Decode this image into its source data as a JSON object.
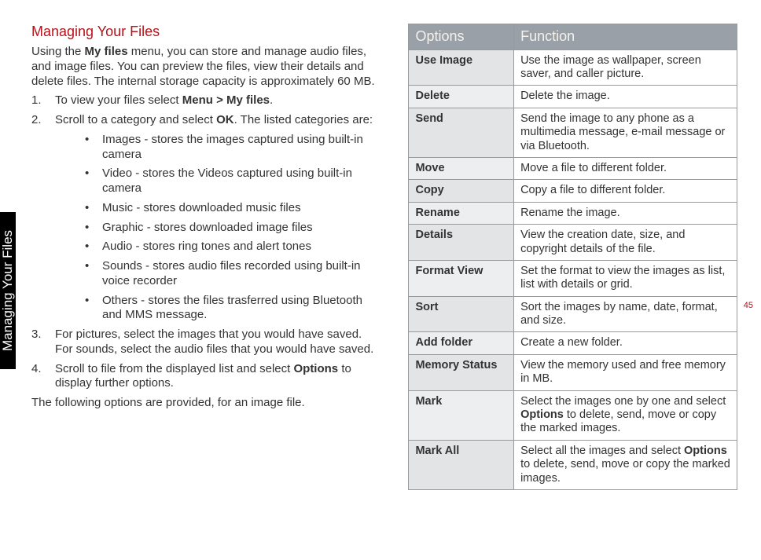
{
  "sideTab": "Managing Your Files",
  "pageNumber": "45",
  "left": {
    "heading": "Managing Your Files",
    "intro_parts": {
      "p1a": "Using the ",
      "p1b": "My files",
      "p1c": " menu, you can store and manage audio files, and image files. You can preview the files, view their details and delete files. The internal storage capacity is approximately 60 MB."
    },
    "step1": {
      "a": "To view your files select ",
      "b": "Menu > My files",
      "c": "."
    },
    "step2": {
      "a": "Scroll to a category and select ",
      "b": "OK",
      "c": ". The listed categories are:"
    },
    "bullets": [
      "Images - stores the images captured using built-in camera",
      "Video - stores the Videos captured using built-in camera",
      "Music - stores downloaded music files",
      "Graphic - stores downloaded image files",
      "Audio - stores ring tones and alert tones",
      "Sounds - stores audio files recorded using built-in voice recorder",
      "Others - stores the files trasferred using Bluetooth and MMS message."
    ],
    "step3": "For pictures, select the images that you would have saved. For sounds, select the audio files that you would have saved.",
    "step4": {
      "a": "Scroll to file from the displayed list and select ",
      "b": "Options",
      "c": " to display further options."
    },
    "outro": "The following options are provided, for an image file."
  },
  "table": {
    "header": {
      "c1": "Options",
      "c2": "Function"
    },
    "rows": [
      {
        "opt": "Use Image",
        "fn": "Use the image as wallpaper, screen saver, and caller picture."
      },
      {
        "opt": "Delete",
        "fn": "Delete the image."
      },
      {
        "opt": "Send",
        "fn": "Send the image to any phone as a multimedia message, e-mail message or via Bluetooth."
      },
      {
        "opt": "Move",
        "fn": "Move a file to different folder."
      },
      {
        "opt": "Copy",
        "fn": "Copy a file to different folder."
      },
      {
        "opt": "Rename",
        "fn": "Rename the image."
      },
      {
        "opt": "Details",
        "fn": "View the creation date, size, and copyright details of the file."
      },
      {
        "opt": "Format View",
        "fn": "Set the format to view the images as list, list with details or grid."
      },
      {
        "opt": "Sort",
        "fn": "Sort the images by name, date, format, and size."
      },
      {
        "opt": "Add folder",
        "fn": "Create a new folder."
      },
      {
        "opt": "Memory Status",
        "fn": "View the memory used and free memory in MB."
      },
      {
        "opt": "Mark",
        "fn_parts": {
          "a": "Select the images one by one and select ",
          "b": "Options",
          "c": " to delete, send, move or copy the marked images."
        }
      },
      {
        "opt": "Mark All",
        "fn_parts": {
          "a": "Select all the images and select ",
          "b": "Options",
          "c": " to delete, send, move or copy the marked images."
        }
      }
    ]
  }
}
